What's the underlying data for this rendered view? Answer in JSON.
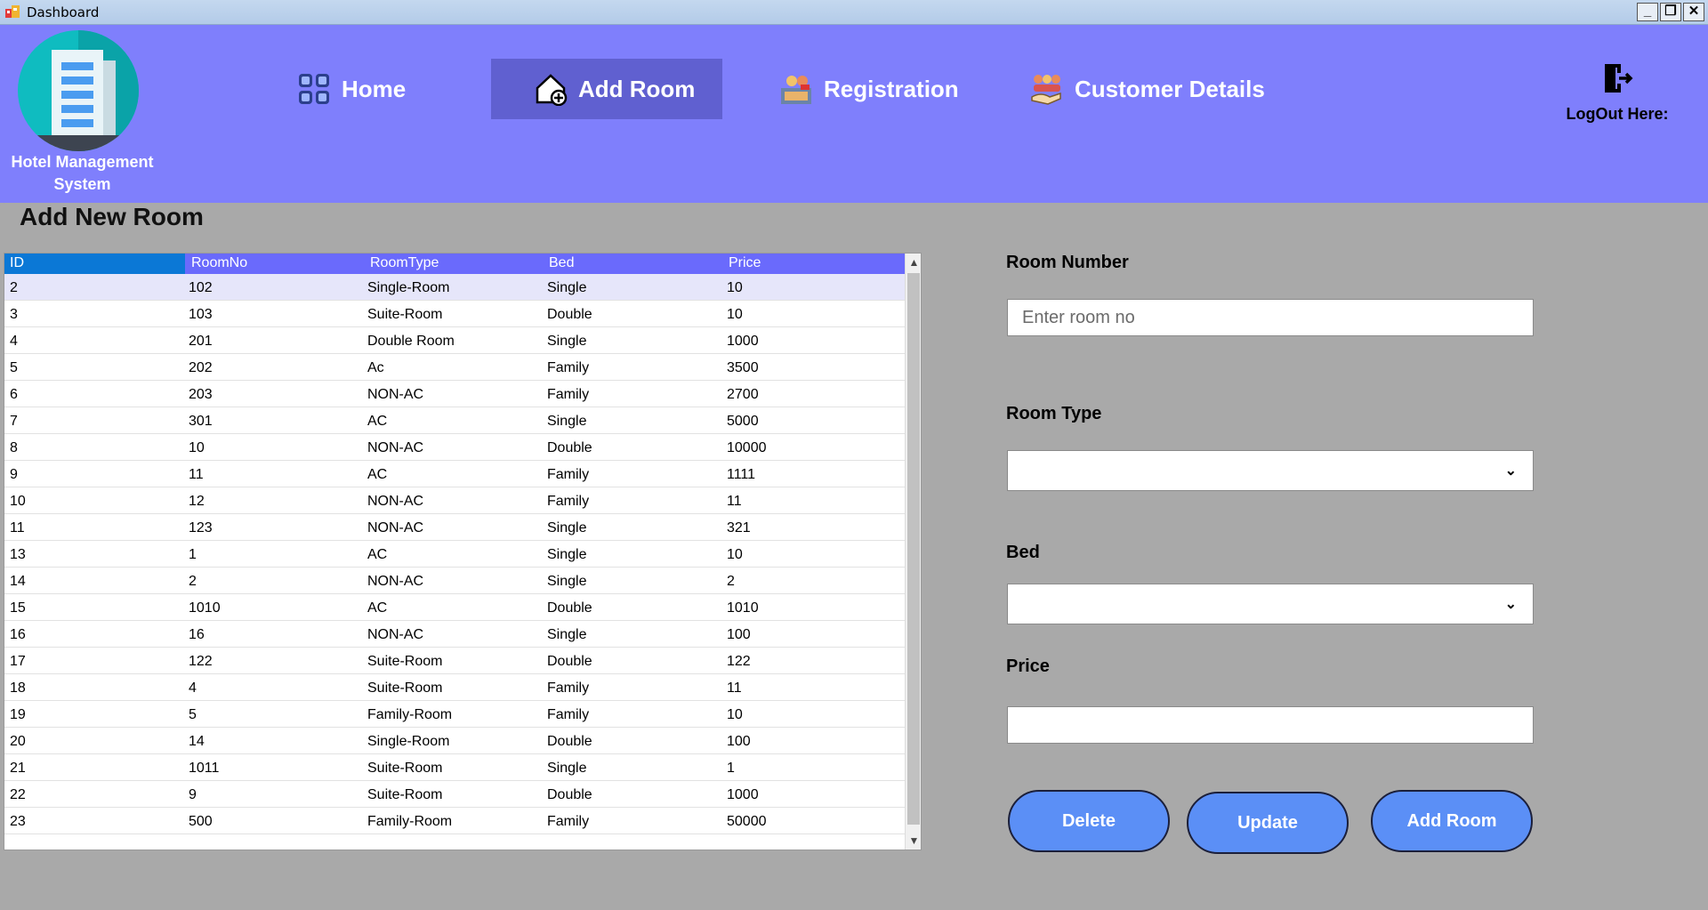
{
  "window": {
    "title": "Dashboard",
    "minimize": "_",
    "maximize": "❐",
    "close": "✕"
  },
  "header": {
    "logo_text": "Hotel Management System",
    "nav": [
      {
        "label": "Home",
        "icon": "grid-icon"
      },
      {
        "label": "Add Room",
        "icon": "add-home-icon",
        "active": true
      },
      {
        "label": "Registration",
        "icon": "reception-icon"
      },
      {
        "label": "Customer Details",
        "icon": "customers-icon"
      }
    ],
    "logout_label": "LogOut Here:"
  },
  "colors": {
    "header": "#7f7ffc",
    "active_nav": "#6060d0",
    "grid_header": "#6a6afc",
    "button": "#5b8ff6",
    "background": "#a9a9a9"
  },
  "main": {
    "title": "Add New Room",
    "grid": {
      "columns": [
        "ID",
        "RoomNo",
        "RoomType",
        "Bed",
        "Price"
      ],
      "rows": [
        [
          "2",
          "102",
          "Single-Room",
          "Single",
          "10"
        ],
        [
          "3",
          "103",
          "Suite-Room",
          "Double",
          "10"
        ],
        [
          "4",
          "201",
          "Double Room",
          "Single",
          "1000"
        ],
        [
          "5",
          "202",
          "Ac",
          "Family",
          "3500"
        ],
        [
          "6",
          "203",
          "NON-AC",
          "Family",
          "2700"
        ],
        [
          "7",
          "301",
          "AC",
          "Single",
          "5000"
        ],
        [
          "8",
          "10",
          "NON-AC",
          "Double",
          "10000"
        ],
        [
          "9",
          "11",
          "AC",
          "Family",
          "1111"
        ],
        [
          "10",
          "12",
          "NON-AC",
          "Family",
          "11"
        ],
        [
          "11",
          "123",
          "NON-AC",
          "Single",
          "321"
        ],
        [
          "13",
          "1",
          "AC",
          "Single",
          "10"
        ],
        [
          "14",
          "2",
          "NON-AC",
          "Single",
          "2"
        ],
        [
          "15",
          "1010",
          "AC",
          "Double",
          "1010"
        ],
        [
          "16",
          "16",
          "NON-AC",
          "Single",
          "100"
        ],
        [
          "17",
          "122",
          "Suite-Room",
          "Double",
          "122"
        ],
        [
          "18",
          "4",
          "Suite-Room",
          "Family",
          "11"
        ],
        [
          "19",
          "5",
          "Family-Room",
          "Family",
          "10"
        ],
        [
          "20",
          "14",
          "Single-Room",
          "Double",
          "100"
        ],
        [
          "21",
          "1011",
          "Suite-Room",
          "Single",
          "1"
        ],
        [
          "22",
          "9",
          "Suite-Room",
          "Double",
          "1000"
        ],
        [
          "23",
          "500",
          "Family-Room",
          "Family",
          "50000"
        ]
      ]
    },
    "form": {
      "room_number_label": "Room Number",
      "room_number_placeholder": "Enter room no",
      "room_number_value": "",
      "room_type_label": "Room Type",
      "room_type_value": "",
      "bed_label": "Bed",
      "bed_value": "",
      "price_label": "Price",
      "price_value": ""
    },
    "buttons": {
      "delete": "Delete",
      "update": "Update",
      "add": "Add Room"
    }
  }
}
